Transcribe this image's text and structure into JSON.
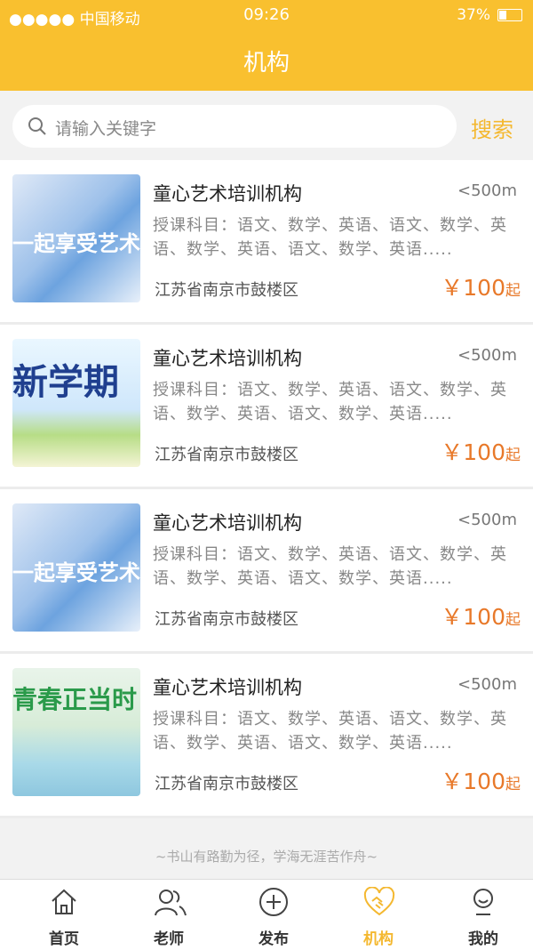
{
  "status_bar": {
    "carrier": "●●●●● 中国移动",
    "time": "09:26",
    "battery": "37%",
    "battery_level": 0.37
  },
  "header": {
    "title": "机构"
  },
  "search": {
    "placeholder": "请输入关键字",
    "button": "搜索"
  },
  "listings": [
    {
      "thumb_text": "一起享受艺术",
      "name": "童心艺术培训机构",
      "distance": "<500m",
      "subjects": "授课科目：语文、数学、英语、语文、数学、英语、数学、英语、语文、数学、英语.....",
      "address": "江苏省南京市鼓楼区",
      "price": "￥100",
      "price_suffix": "起"
    },
    {
      "thumb_text": "新学期",
      "name": "童心艺术培训机构",
      "distance": "<500m",
      "subjects": "授课科目：语文、数学、英语、语文、数学、英语、数学、英语、语文、数学、英语.....",
      "address": "江苏省南京市鼓楼区",
      "price": "￥100",
      "price_suffix": "起"
    },
    {
      "thumb_text": "一起享受艺术",
      "name": "童心艺术培训机构",
      "distance": "<500m",
      "subjects": "授课科目：语文、数学、英语、语文、数学、英语、数学、英语、语文、数学、英语.....",
      "address": "江苏省南京市鼓楼区",
      "price": "￥100",
      "price_suffix": "起"
    },
    {
      "thumb_text": "青春正当时",
      "name": "童心艺术培训机构",
      "distance": "<500m",
      "subjects": "授课科目：语文、数学、英语、语文、数学、英语、数学、英语、语文、数学、英语.....",
      "address": "江苏省南京市鼓楼区",
      "price": "￥100",
      "price_suffix": "起"
    }
  ],
  "slogan": "~书山有路勤为径，学海无涯苦作舟~",
  "tabs": [
    {
      "label": "首页",
      "icon": "home-icon"
    },
    {
      "label": "老师",
      "icon": "teachers-icon"
    },
    {
      "label": "发布",
      "icon": "publish-icon"
    },
    {
      "label": "机构",
      "icon": "institution-icon",
      "active": true
    },
    {
      "label": "我的",
      "icon": "profile-icon"
    }
  ],
  "colors": {
    "accent": "#f9c02f",
    "price": "#e8792a",
    "active_tab": "#f4b830"
  }
}
